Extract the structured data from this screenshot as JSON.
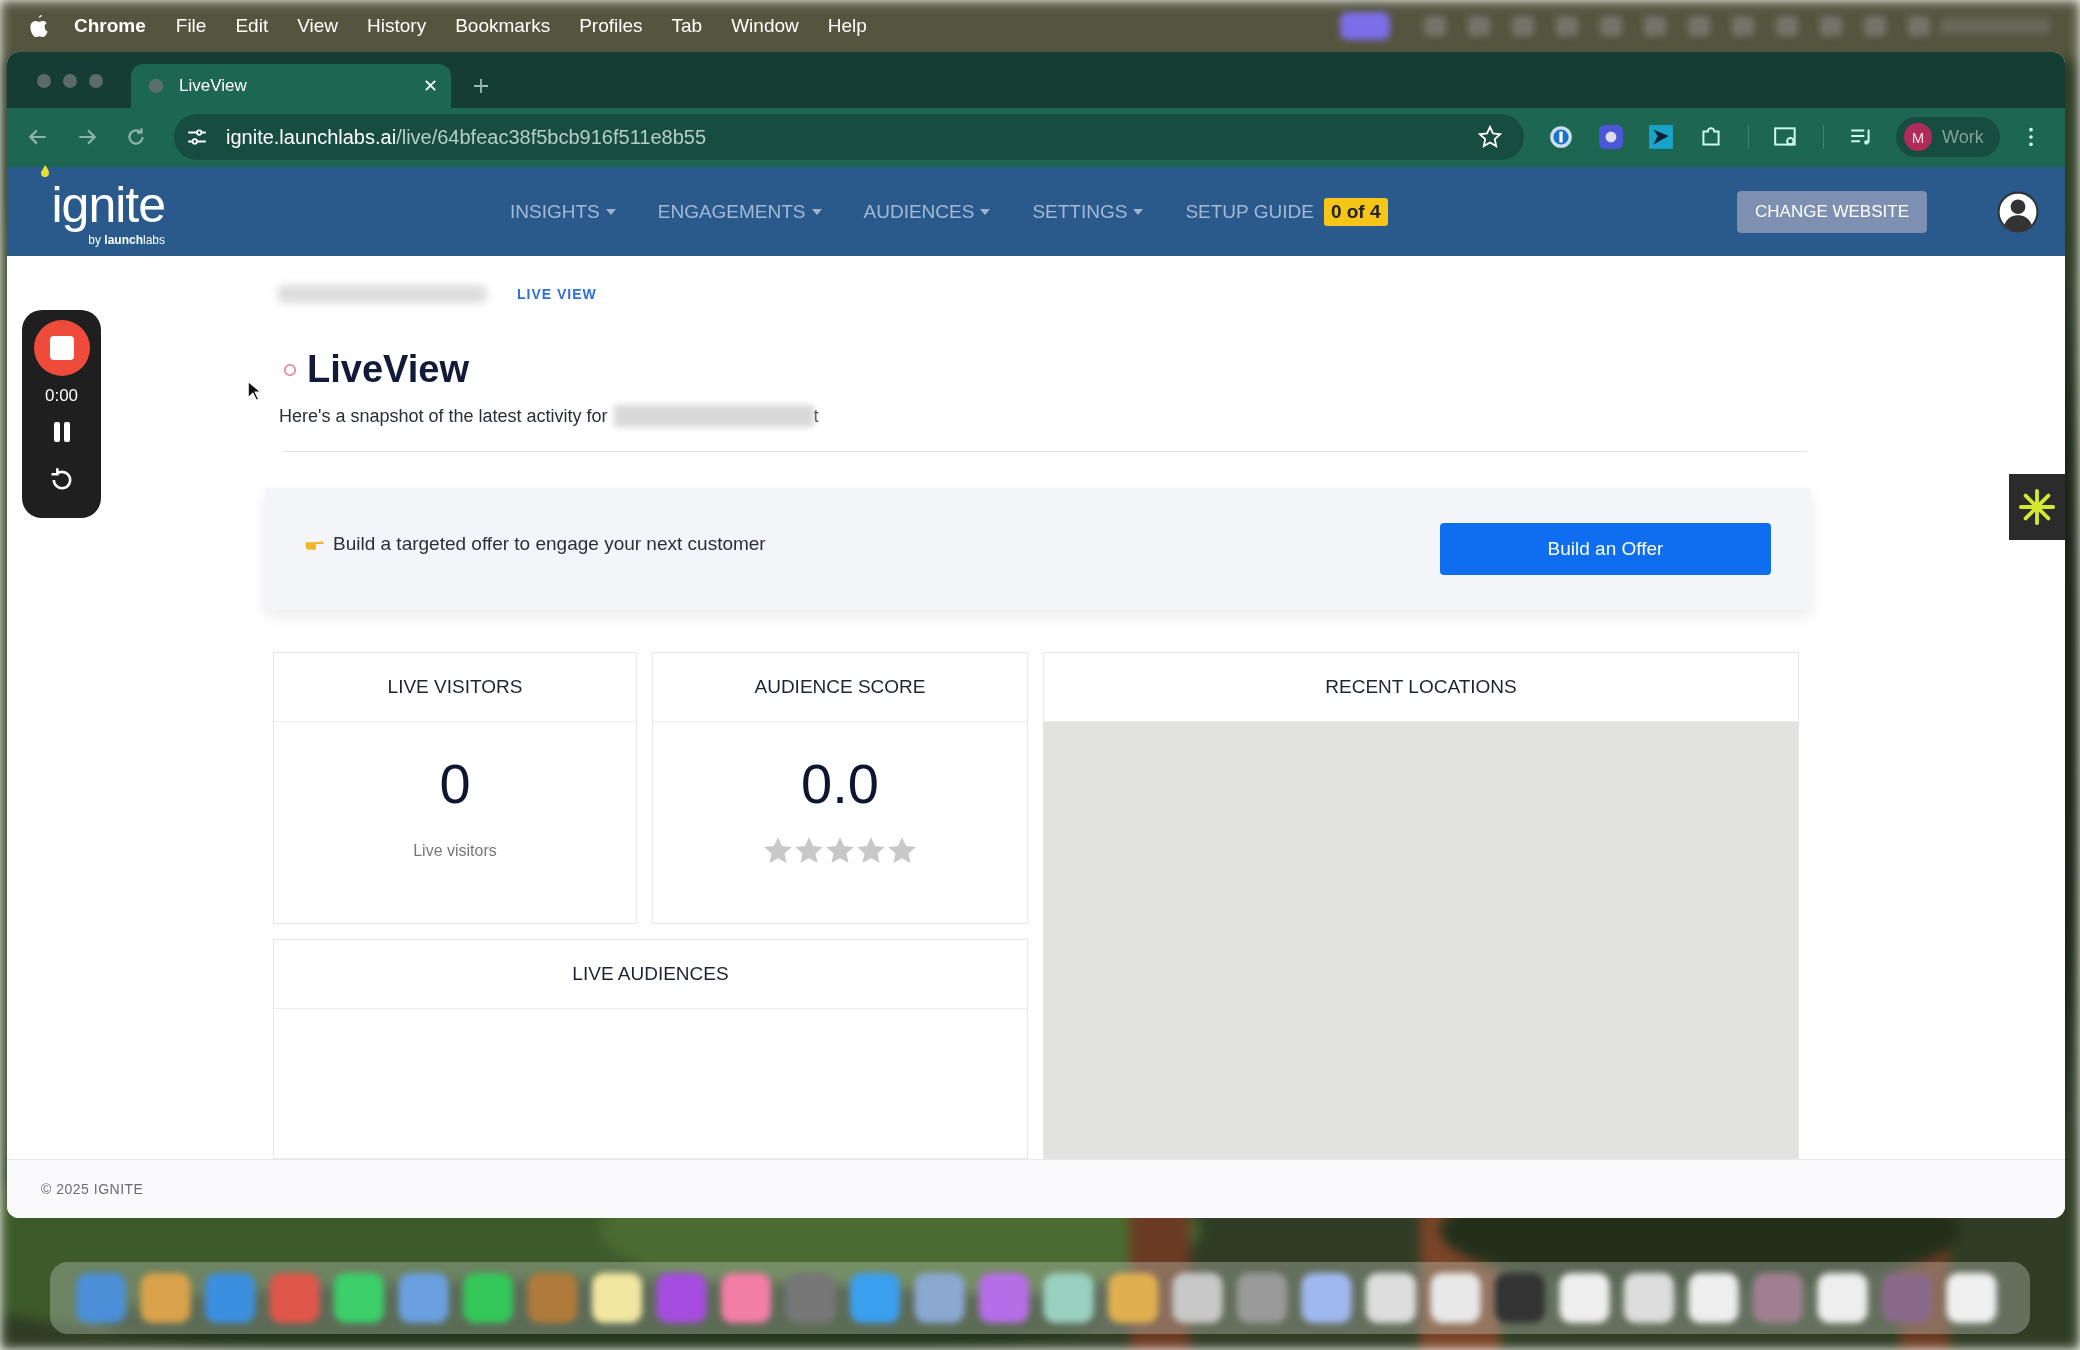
{
  "menu_bar": {
    "app": "Chrome",
    "items": [
      "File",
      "Edit",
      "View",
      "History",
      "Bookmarks",
      "Profiles",
      "Tab",
      "Window",
      "Help"
    ]
  },
  "browser": {
    "tab": {
      "title": "LiveView"
    },
    "url": {
      "host": "ignite.launchlabs.ai",
      "path": "/live/64bfeac38f5bcb916f511e8b55"
    },
    "profile": {
      "initial": "M",
      "label": "Work"
    }
  },
  "header": {
    "logo": {
      "name": "ignite",
      "byline": "by **launch**labs"
    },
    "nav": [
      {
        "label": "INSIGHTS",
        "dropdown": true
      },
      {
        "label": "ENGAGEMENTS",
        "dropdown": true
      },
      {
        "label": "AUDIENCES",
        "dropdown": true
      },
      {
        "label": "SETTINGS",
        "dropdown": true
      },
      {
        "label": "SETUP GUIDE",
        "dropdown": false,
        "badge": "0 of 4"
      }
    ],
    "change_website": "CHANGE WEBSITE"
  },
  "recorder": {
    "time": "0:00"
  },
  "breadcrumb": {
    "current": "LIVE VIEW"
  },
  "page": {
    "title": "LiveView",
    "subtitle": "Here's a snapshot of the latest activity for",
    "subtitle_tail": "t"
  },
  "offer": {
    "text": "Build a targeted offer to engage your next customer",
    "button": "Build an Offer"
  },
  "cards": {
    "live_visitors": {
      "title": "LIVE VISITORS",
      "value": "0",
      "caption": "Live visitors"
    },
    "audience_score": {
      "title": "AUDIENCE SCORE",
      "value": "0.0",
      "stars": 0
    },
    "recent_locations": {
      "title": "RECENT LOCATIONS"
    },
    "live_audiences": {
      "title": "LIVE AUDIENCES"
    }
  },
  "footer": "© 2025 IGNITE"
}
